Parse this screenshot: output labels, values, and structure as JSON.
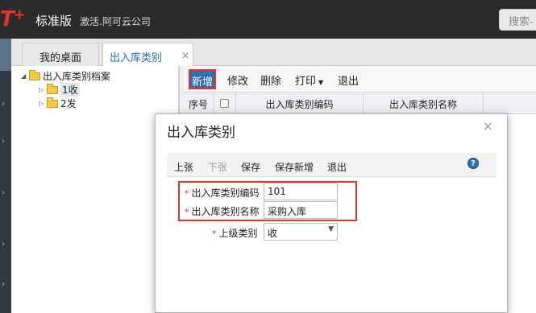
{
  "topbar": {
    "logo_text": "T",
    "logo_plus": "+",
    "edition": "标准版",
    "company": "激活.阿可云公司",
    "search_placeholder": "搜索-"
  },
  "tabs": [
    {
      "label": "我的桌面"
    },
    {
      "label": "出入库类别",
      "close": "×"
    }
  ],
  "tree": {
    "root": "出入库类别档案",
    "children": [
      {
        "label": "1收"
      },
      {
        "label": "2发"
      }
    ]
  },
  "content_toolbar": {
    "new": "新增",
    "edit": "修改",
    "delete": "删除",
    "print": "打印",
    "exit": "退出"
  },
  "grid": {
    "headers": [
      "序号",
      "",
      "出入库类别编码",
      "出入库类别名称"
    ]
  },
  "dialog": {
    "title": "出入库类别",
    "close": "×",
    "toolbar": {
      "prev": "上张",
      "next": "下张",
      "save": "保存",
      "save_new": "保存新增",
      "exit": "退出"
    },
    "help": "?",
    "fields": {
      "code": {
        "label": "出入库类别编码",
        "value": "101",
        "required": "*"
      },
      "name": {
        "label": "出入库类别名称",
        "value": "采购入库",
        "required": "*"
      },
      "parent": {
        "label": "上级类别",
        "value": "收",
        "required": "*"
      }
    }
  },
  "colors": {
    "topbar": "#2b2b2b",
    "brand_red": "#e5322d",
    "primary_blue": "#2f6fae",
    "highlight": "#e5322d"
  }
}
